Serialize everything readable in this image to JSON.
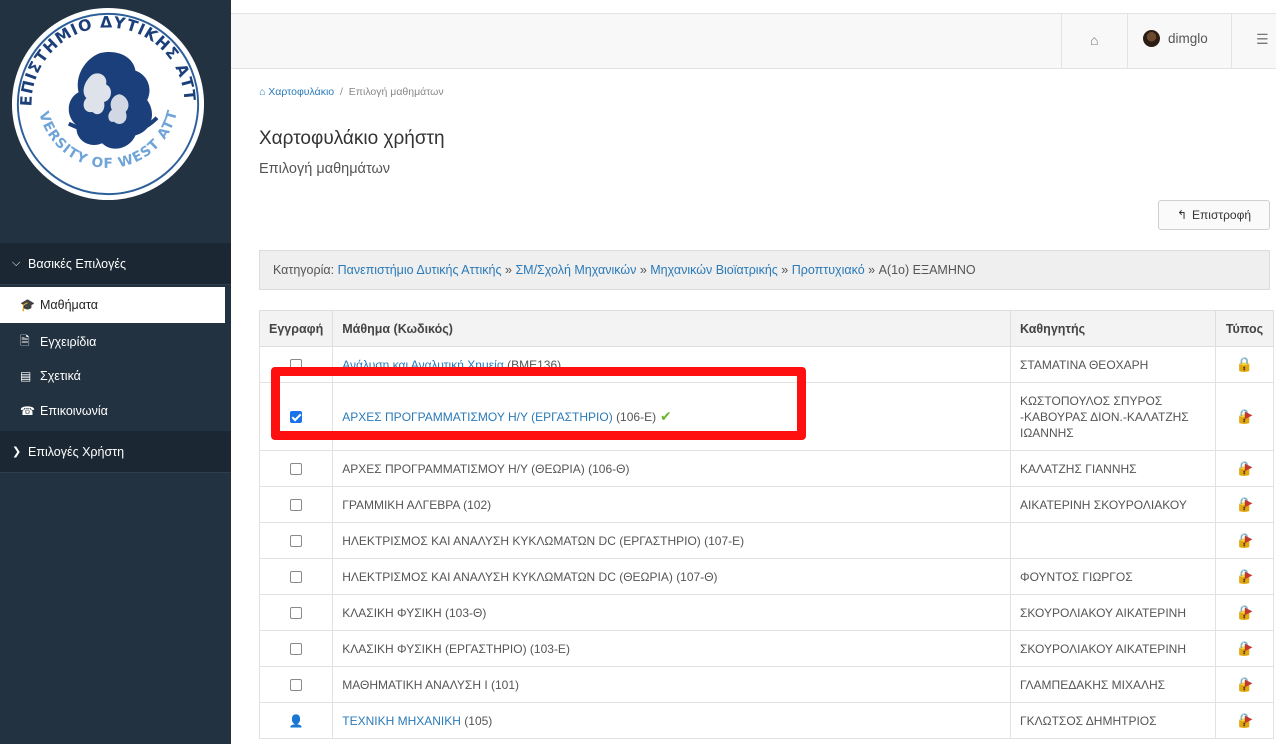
{
  "sidebar": {
    "logo": {
      "arc_top": "ΠΑΝΕΠΙΣΤΗΜΙΟ ΔΥΤΙΚΗΣ ΑΤΤΙΚΗΣ",
      "arc_bottom": "UNIVERSITY OF WEST ATTICA",
      "colors": {
        "ring": "#2d5f9a",
        "figure": "#1b3f7a"
      }
    },
    "groups": [
      {
        "label": "Βασικές Επιλογές",
        "icon": "chevron-down-icon"
      },
      {
        "label": "Επιλογές Χρήστη",
        "icon": "chevron-right-icon"
      }
    ],
    "items": [
      {
        "label": "Μαθήματα",
        "icon": "graduation-cap-icon",
        "active": true
      },
      {
        "label": "Εγχειρίδια",
        "icon": "document-icon",
        "active": false
      },
      {
        "label": "Σχετικά",
        "icon": "card-icon",
        "active": false
      },
      {
        "label": "Επικοινωνία",
        "icon": "phone-icon",
        "active": false
      }
    ]
  },
  "topbar": {
    "user": "dimglo",
    "home_icon": "home-icon",
    "settings_icon": "sliders-icon"
  },
  "breadcrumb": {
    "root": "Χαρτοφυλάκιο",
    "current": "Επιλογή μαθημάτων"
  },
  "page": {
    "title": "Χαρτοφυλάκιο χρήστη",
    "subtitle": "Επιλογή μαθημάτων"
  },
  "back_button": {
    "label": "Επιστροφή",
    "icon": "reply-icon"
  },
  "category": {
    "prefix": "Κατηγορία:",
    "links": [
      "Πανεπιστήμιο Δυτικής Αττικής",
      "ΣΜ/Σχολή Μηχανικών",
      "Μηχανικών Βιοϊατρικής",
      "Προπτυχιακό"
    ],
    "separator": "»",
    "current": "Α(1ο) ΕΞΑΜΗΝΟ"
  },
  "table": {
    "headers": {
      "enroll": "Εγγραφή",
      "course": "Μάθημα (Κωδικός)",
      "teacher": "Καθηγητής",
      "type": "Τύπος"
    },
    "rows": [
      {
        "course": "Ανάλυση και Αναλυτική Χημεία",
        "code": "(BME136)",
        "teacher": "ΣΤΑΜΑΤΙΝΑ ΘΕΟΧΑΡΗ",
        "linked": true,
        "enroll": "checkbox",
        "checked": false,
        "type_icon": "lock-icon"
      },
      {
        "course": "ΑΡΧΕΣ ΠΡΟΓΡΑΜΜΑΤΙΣΜΟΥ Η/Υ (ΕΡΓΑΣΤΗΡΙΟ)",
        "code": "(106-Ε)",
        "teacher": "ΚΩΣΤΟΠΟΥΛΟΣ ΣΠΥΡΟΣ -ΚΑΒΟΥΡΑΣ ΔΙΟΝ.-ΚΑΛΑΤΖΗΣ ΙΩΑΝΝΗΣ",
        "linked": true,
        "enroll": "checkbox",
        "checked": true,
        "enrolled_tick": true,
        "type_icon": "lock-arrow-icon"
      },
      {
        "course": "ΑΡΧΕΣ ΠΡΟΓΡΑΜΜΑΤΙΣΜΟΥ Η/Υ (ΘΕΩΡΙΑ)",
        "code": "(106-Θ)",
        "teacher": "ΚΑΛΑΤΖΗΣ ΓΙΑΝΝΗΣ",
        "linked": false,
        "enroll": "checkbox",
        "checked": false,
        "type_icon": "lock-arrow-icon"
      },
      {
        "course": "ΓΡΑΜΜΙΚΗ ΑΛΓΕΒΡΑ",
        "code": "(102)",
        "teacher": "ΑΙΚΑΤΕΡΙΝΗ ΣΚΟΥΡΟΛΙΑΚΟΥ",
        "linked": false,
        "enroll": "checkbox",
        "checked": false,
        "type_icon": "lock-arrow-icon"
      },
      {
        "course": "ΗΛΕΚΤΡΙΣΜΟΣ ΚΑΙ ΑΝΑΛΥΣΗ ΚΥΚΛΩΜΑΤΩΝ DC (ΕΡΓΑΣΤΗΡΙΟ)",
        "code": "(107-Ε)",
        "teacher": "",
        "linked": false,
        "enroll": "checkbox",
        "checked": false,
        "type_icon": "lock-arrow-icon"
      },
      {
        "course": "ΗΛΕΚΤΡΙΣΜΟΣ ΚΑΙ ΑΝΑΛΥΣΗ ΚΥΚΛΩΜΑΤΩΝ DC (ΘΕΩΡΙΑ)",
        "code": "(107-Θ)",
        "teacher": "ΦΟΥΝΤΟΣ ΓΙΩΡΓΟΣ",
        "linked": false,
        "enroll": "checkbox",
        "checked": false,
        "type_icon": "lock-arrow-icon"
      },
      {
        "course": "ΚΛΑΣΙΚΗ ΦΥΣΙΚΗ",
        "code": "(103-Θ)",
        "teacher": "ΣΚΟΥΡΟΛΙΑΚΟΥ ΑΙΚΑΤΕΡΙΝΗ",
        "linked": false,
        "enroll": "checkbox",
        "checked": false,
        "type_icon": "lock-arrow-icon"
      },
      {
        "course": "ΚΛΑΣΙΚΗ ΦΥΣΙΚΗ (ΕΡΓΑΣΤΗΡΙΟ)",
        "code": "(103-Ε)",
        "teacher": "ΣΚΟΥΡΟΛΙΑΚΟΥ ΑΙΚΑΤΕΡΙΝΗ",
        "linked": false,
        "enroll": "checkbox",
        "checked": false,
        "type_icon": "lock-arrow-icon"
      },
      {
        "course": "ΜΑΘΗΜΑΤΙΚΗ ΑΝΑΛΥΣΗ Ι",
        "code": "(101)",
        "teacher": "ΓΛΑΜΠΕΔΑΚΗΣ ΜΙΧΑΛΗΣ",
        "linked": false,
        "enroll": "checkbox",
        "checked": false,
        "type_icon": "lock-arrow-icon"
      },
      {
        "course": "ΤΕΧΝΙΚΗ ΜΗΧΑΝΙΚΗ",
        "code": "(105)",
        "teacher": "ΓΚΛΩΤΣΟΣ ΔΗΜΗΤΡΙΟΣ",
        "linked": true,
        "enroll": "user",
        "checked": false,
        "type_icon": "lock-arrow-icon"
      }
    ]
  },
  "highlight": {
    "color": "#ff1010"
  }
}
